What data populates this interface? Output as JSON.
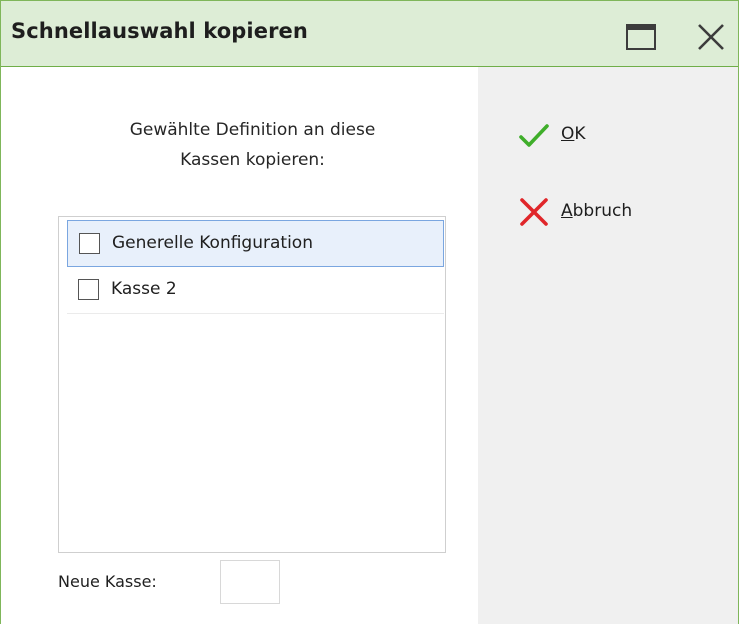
{
  "window": {
    "title": "Schnellauswahl kopieren",
    "controls": [
      "maximize-icon",
      "close-icon"
    ]
  },
  "content": {
    "instruction_line1": "Gewählte Definition an diese",
    "instruction_line2": "Kassen kopieren:",
    "list": [
      {
        "label": "Generelle Konfiguration",
        "checked": false,
        "selected": true
      },
      {
        "label": "Kasse 2",
        "checked": false,
        "selected": false
      }
    ],
    "new_register_label": "Neue Kasse:",
    "new_register_value": ""
  },
  "actions": {
    "ok_accel": "O",
    "ok_rest": "K",
    "cancel_accel": "A",
    "cancel_rest": "bbruch"
  },
  "colors": {
    "titlebar_bg": "#ddedd6",
    "accent_green": "#6fae48",
    "ok_green": "#3fae2a",
    "cancel_red": "#e0262a",
    "selection_border": "#7aa6e0",
    "side_panel": "#f0f0f0"
  }
}
